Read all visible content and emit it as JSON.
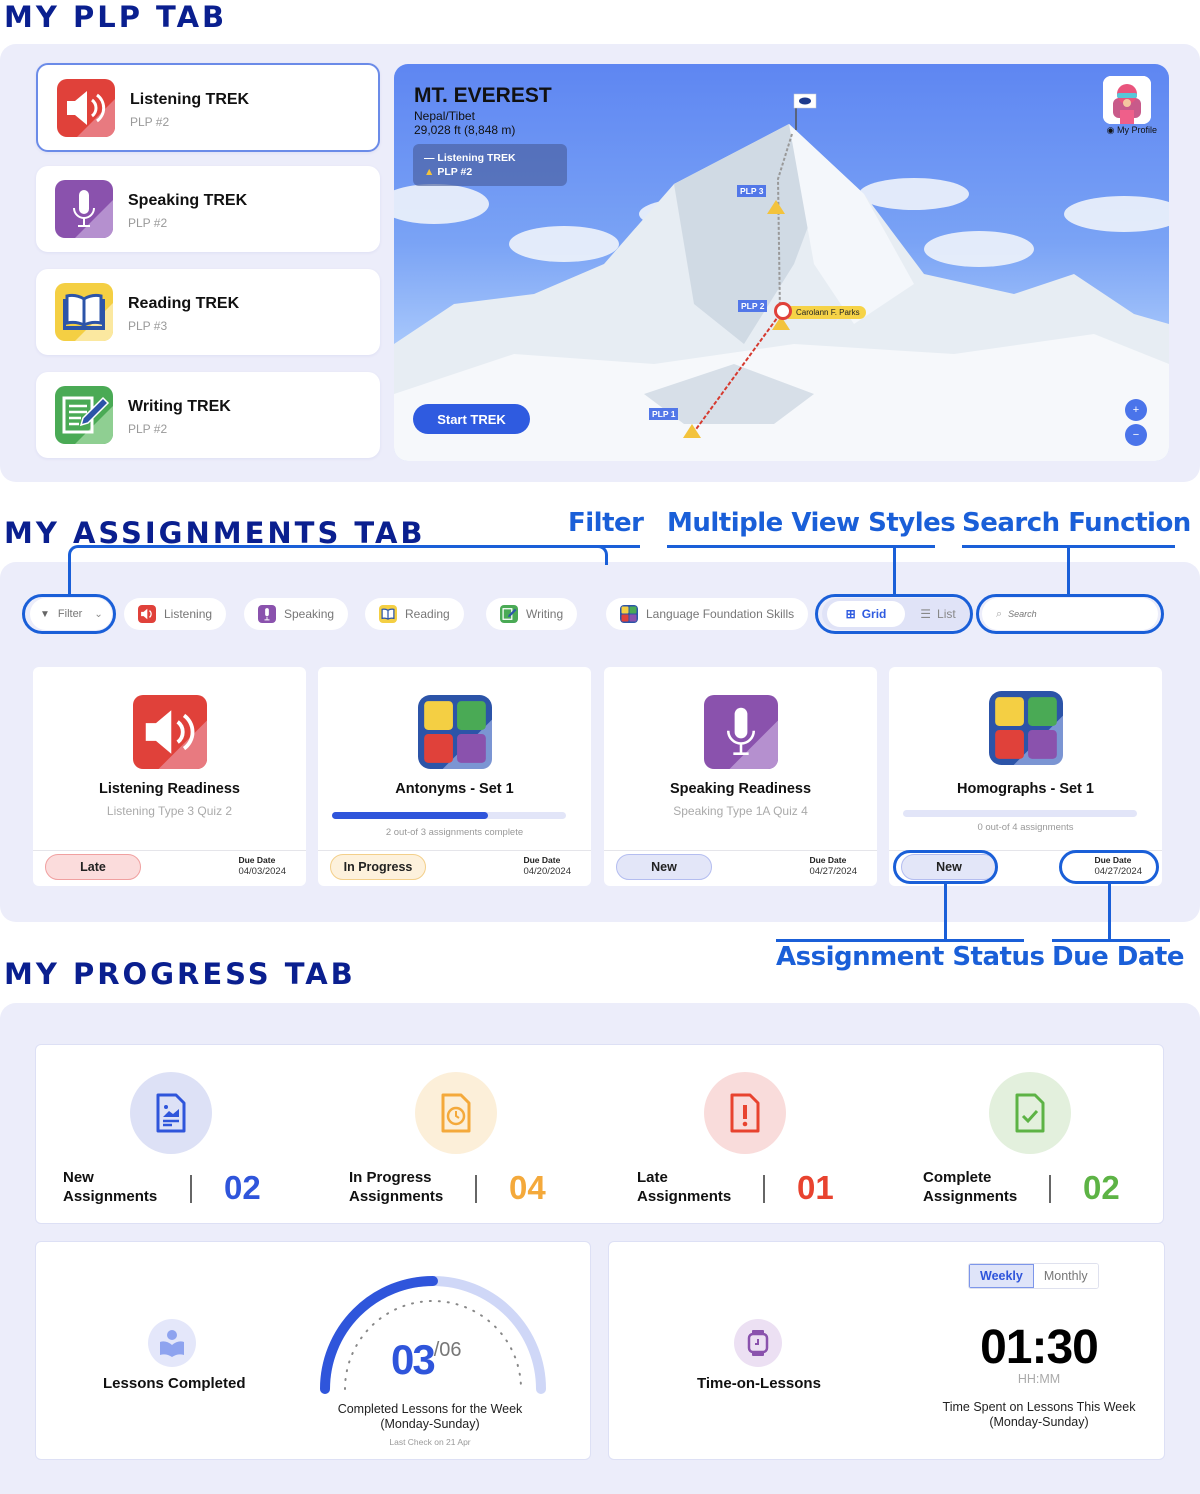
{
  "sections": {
    "plp_title": "MY PLP TAB",
    "assignments_title": "MY ASSIGNMENTS TAB",
    "progress_title": "MY PROGRESS TAB"
  },
  "callouts": {
    "filter": "Filter",
    "view_styles": "Multiple View Styles",
    "search": "Search Function",
    "status": "Assignment Status",
    "due_date": "Due Date"
  },
  "plp": {
    "treks": [
      {
        "title": "Listening TREK",
        "plp": "PLP #2",
        "icon": "speaker-icon",
        "active": true
      },
      {
        "title": "Speaking TREK",
        "plp": "PLP #2",
        "icon": "microphone-icon",
        "active": false
      },
      {
        "title": "Reading TREK",
        "plp": "PLP #3",
        "icon": "book-icon",
        "active": false
      },
      {
        "title": "Writing TREK",
        "plp": "PLP #2",
        "icon": "pencil-notepad-icon",
        "active": false
      }
    ],
    "map": {
      "mountain": "MT. EVEREST",
      "location": "Nepal/Tibet",
      "height": "29,028 ft (8,848 m)",
      "legend_line": "— Listening TREK",
      "legend_camp": "PLP #2",
      "camps": [
        "PLP 1",
        "PLP 2",
        "PLP 3"
      ],
      "student_name": "Carolann F. Parks",
      "profile_label": "My Profile",
      "start_button": "Start TREK",
      "zoom_in": "+",
      "zoom_out": "−"
    }
  },
  "assignments": {
    "filter_label": "Filter",
    "chips": [
      {
        "label": "Listening",
        "icon": "speaker-icon"
      },
      {
        "label": "Speaking",
        "icon": "microphone-icon"
      },
      {
        "label": "Reading",
        "icon": "book-icon"
      },
      {
        "label": "Writing",
        "icon": "pencil-notepad-icon"
      },
      {
        "label": "Language Foundation Skills",
        "icon": "four-skills-icon"
      }
    ],
    "view_grid": "Grid",
    "view_list": "List",
    "search_placeholder": "Search",
    "due_label": "Due Date",
    "cards": [
      {
        "title": "Listening Readiness",
        "subtitle": "Listening Type 3 Quiz 2",
        "status": "Late",
        "due": "04/03/2024"
      },
      {
        "title": "Antonyms - Set 1",
        "progress_text": "2 out-of 3 assignments complete",
        "progress": 0.667,
        "status": "In Progress",
        "due": "04/20/2024"
      },
      {
        "title": "Speaking Readiness",
        "subtitle": "Speaking Type 1A Quiz 4",
        "status": "New",
        "due": "04/27/2024"
      },
      {
        "title": "Homographs - Set 1",
        "progress_text": "0 out-of 4 assignments",
        "progress": 0,
        "status": "New",
        "due": "04/27/2024"
      }
    ]
  },
  "progress": {
    "stats": [
      {
        "label_1": "New",
        "label_2": "Assignments",
        "value": "02",
        "color": "#2f55db"
      },
      {
        "label_1": "In Progress",
        "label_2": "Assignments",
        "value": "04",
        "color": "#f4a93b"
      },
      {
        "label_1": "Late",
        "label_2": "Assignments",
        "value": "01",
        "color": "#e8432f"
      },
      {
        "label_1": "Complete",
        "label_2": "Assignments",
        "value": "02",
        "color": "#5db345"
      }
    ],
    "lessons": {
      "label": "Lessons Completed",
      "completed": "03",
      "total": "/06",
      "fraction": 0.5,
      "caption_1": "Completed Lessons for the Week",
      "caption_2": "(Monday-Sunday)",
      "last_check": "Last Check on 21 Apr"
    },
    "time": {
      "label": "Time-on-Lessons",
      "tab_weekly": "Weekly",
      "tab_monthly": "Monthly",
      "value": "01:30",
      "unit": "HH:MM",
      "caption_1": "Time Spent on Lessons This Week",
      "caption_2": "(Monday-Sunday)"
    }
  }
}
